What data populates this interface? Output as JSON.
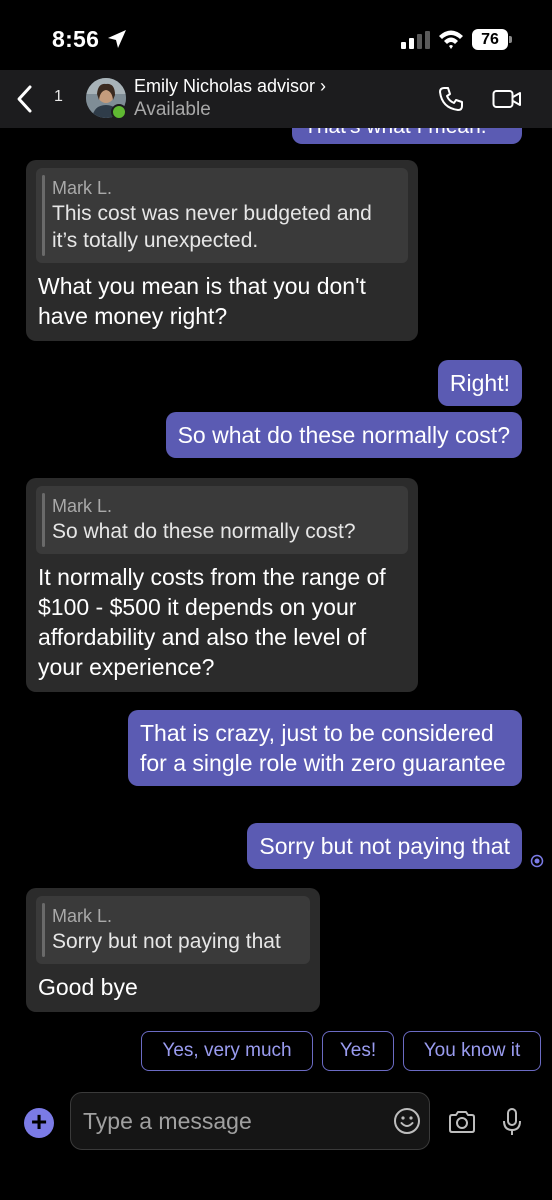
{
  "status_bar": {
    "time": "8:56",
    "battery": "76"
  },
  "header": {
    "back_count": "1",
    "contact_name": "Emily Nicholas advisor ›",
    "contact_status": "Available"
  },
  "messages": {
    "m0_partial": "That's what I mean.",
    "m1": {
      "quote_author": "Mark L.",
      "quote_text": "This cost was never budgeted and it’s totally unexpected.",
      "text": "What you mean is that you don't have money right?"
    },
    "m2": "Right!",
    "m3": "So what do these normally cost?",
    "m4": {
      "quote_author": "Mark L.",
      "quote_text": "So what do these normally cost?",
      "text": "It normally costs from the range of $100 - $500 it depends on your affordability and also the level of your experience?"
    },
    "m5": "That is crazy, just to be considered for a single role with zero guarantee",
    "m6": "Sorry but not paying that",
    "m7": {
      "quote_author": "Mark L.",
      "quote_text": "Sorry but not paying that",
      "text": "Good bye"
    }
  },
  "suggestions": [
    "Yes, very much",
    "Yes!",
    "You know it"
  ],
  "compose": {
    "placeholder": "Type a message"
  },
  "colors": {
    "outgoing_bubble": "#5b5bb3",
    "incoming_bubble": "#2b2b2b",
    "accent": "#7b7be6",
    "presence": "#5fb832"
  },
  "icons": [
    "location-arrow-icon",
    "signal-icon",
    "wifi-icon",
    "back-chevron-icon",
    "phone-icon",
    "video-icon",
    "read-receipt-icon",
    "plus-icon",
    "emoji-icon",
    "camera-icon",
    "mic-icon"
  ]
}
